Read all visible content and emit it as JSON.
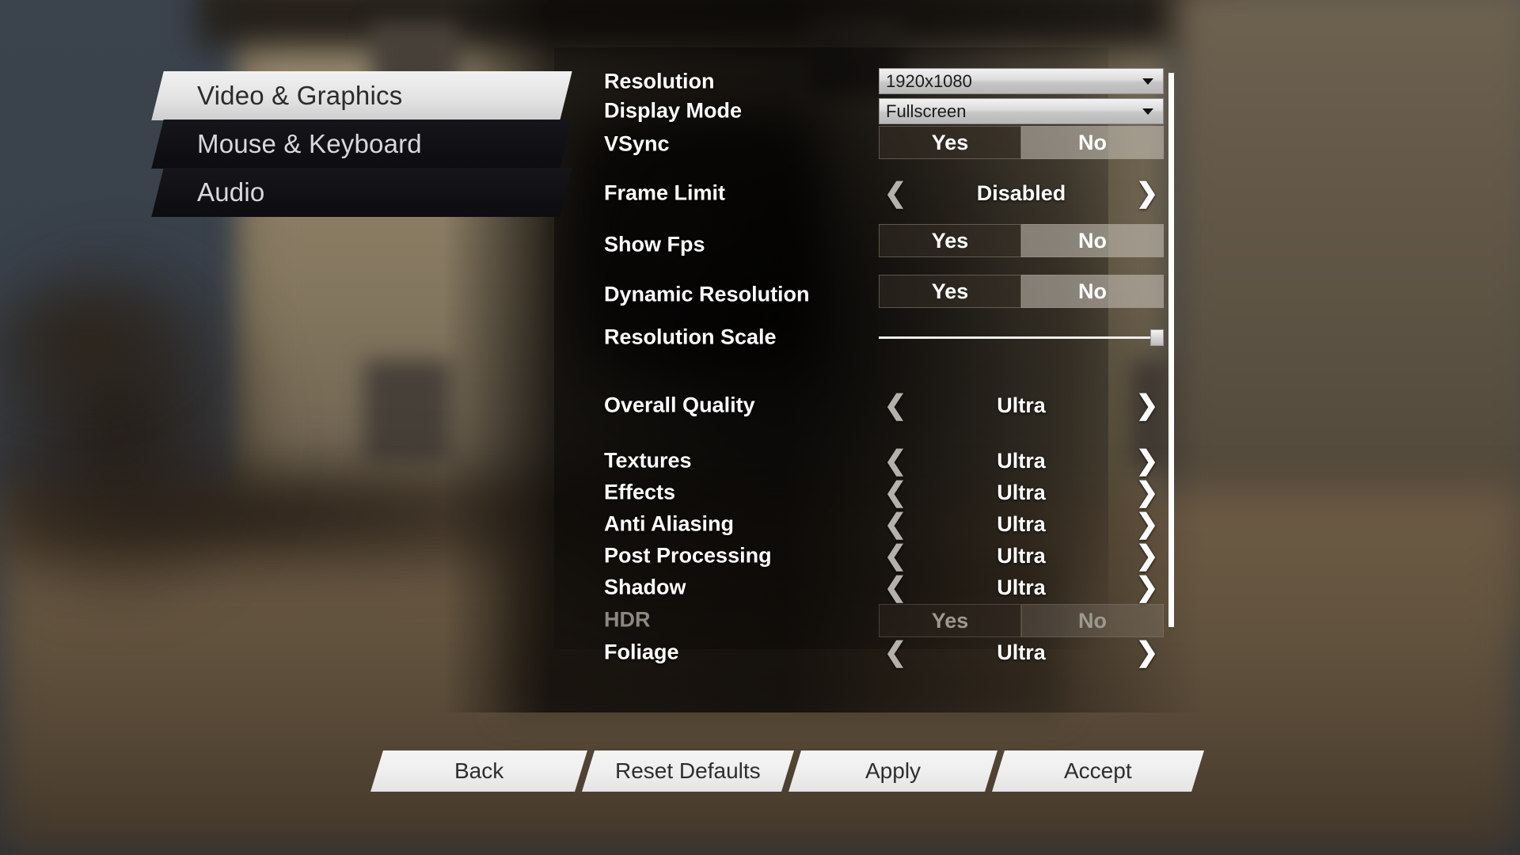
{
  "tabs": [
    {
      "label": "Video & Graphics",
      "selected": true
    },
    {
      "label": "Mouse & Keyboard",
      "selected": false
    },
    {
      "label": "Audio",
      "selected": false
    }
  ],
  "settings": {
    "resolution": {
      "label": "Resolution",
      "type": "dropdown",
      "value": "1920x1080"
    },
    "display_mode": {
      "label": "Display Mode",
      "type": "dropdown",
      "value": "Fullscreen"
    },
    "vsync": {
      "label": "VSync",
      "type": "toggle",
      "yes": "Yes",
      "no": "No",
      "value": "No"
    },
    "frame_limit": {
      "label": "Frame Limit",
      "type": "spinner",
      "value": "Disabled",
      "prev": "❮",
      "next": "❯"
    },
    "show_fps": {
      "label": "Show Fps",
      "type": "toggle",
      "yes": "Yes",
      "no": "No",
      "value": "No"
    },
    "dynamic_resolution": {
      "label": "Dynamic Resolution",
      "type": "toggle",
      "yes": "Yes",
      "no": "No",
      "value": "No"
    },
    "resolution_scale": {
      "label": "Resolution Scale",
      "type": "slider",
      "percent": 100
    },
    "overall_quality": {
      "label": "Overall Quality",
      "type": "spinner",
      "value": "Ultra",
      "prev": "❮",
      "next": "❯"
    },
    "textures": {
      "label": "Textures",
      "type": "spinner",
      "value": "Ultra",
      "prev": "❮",
      "next": "❯"
    },
    "effects": {
      "label": "Effects",
      "type": "spinner",
      "value": "Ultra",
      "prev": "❮",
      "next": "❯"
    },
    "anti_aliasing": {
      "label": "Anti Aliasing",
      "type": "spinner",
      "value": "Ultra",
      "prev": "❮",
      "next": "❯"
    },
    "post_processing": {
      "label": "Post Processing",
      "type": "spinner",
      "value": "Ultra",
      "prev": "❮",
      "next": "❯"
    },
    "shadow": {
      "label": "Shadow",
      "type": "spinner",
      "value": "Ultra",
      "prev": "❮",
      "next": "❯"
    },
    "hdr": {
      "label": "HDR",
      "type": "toggle",
      "yes": "Yes",
      "no": "No",
      "value": "No",
      "disabled": true
    },
    "foliage": {
      "label": "Foliage",
      "type": "spinner",
      "value": "Ultra",
      "prev": "❮",
      "next": "❯"
    }
  },
  "actions": [
    {
      "label": "Back"
    },
    {
      "label": "Reset Defaults"
    },
    {
      "label": "Apply"
    },
    {
      "label": "Accept"
    }
  ],
  "colors": {
    "tab_active_bg": "#e9e9e9",
    "tab_idle_bg": "#0f0f13",
    "label_text": "#ffffff",
    "disabled_text": "#8c8880",
    "dropdown_bg": "#dcdcdc",
    "scrollbar": "#ffffff"
  }
}
